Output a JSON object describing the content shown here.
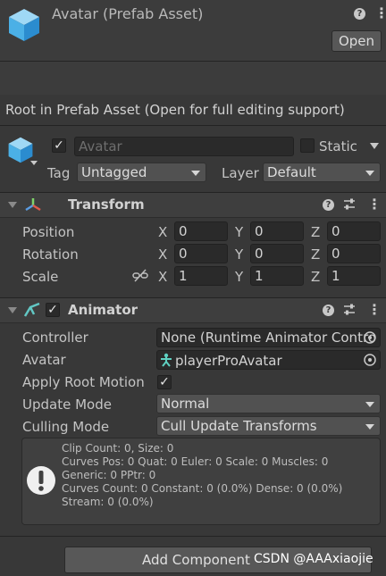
{
  "header": {
    "title": "Avatar (Prefab Asset)",
    "open_label": "Open"
  },
  "info_text": "Root in Prefab Asset (Open for full editing support)",
  "gameobject": {
    "name": "Avatar",
    "static_label": "Static",
    "tag_label": "Tag",
    "tag_value": "Untagged",
    "layer_label": "Layer",
    "layer_value": "Default"
  },
  "transform": {
    "title": "Transform",
    "rows": [
      {
        "label": "Position",
        "x": "0",
        "y": "0",
        "z": "0"
      },
      {
        "label": "Rotation",
        "x": "0",
        "y": "0",
        "z": "0"
      },
      {
        "label": "Scale",
        "x": "1",
        "y": "1",
        "z": "1"
      }
    ],
    "axis_x": "X",
    "axis_y": "Y",
    "axis_z": "Z"
  },
  "animator": {
    "title": "Animator",
    "controller_label": "Controller",
    "controller_value": "None (Runtime Animator Contro",
    "avatar_label": "Avatar",
    "avatar_value": "playerProAvatar",
    "apply_root_motion_label": "Apply Root Motion",
    "update_mode_label": "Update Mode",
    "update_mode_value": "Normal",
    "culling_mode_label": "Culling Mode",
    "culling_mode_value": "Cull Update Transforms",
    "info_lines": [
      "Clip Count: 0, Size: 0",
      "Curves Pos: 0 Quat: 0 Euler: 0 Scale: 0 Muscles: 0",
      "Generic: 0 PPtr: 0",
      "Curves Count: 0 Constant: 0 (0.0%) Dense: 0 (0.0%)",
      "Stream: 0 (0.0%)"
    ]
  },
  "add_component_label": "Add Component",
  "watermark": "CSDN @AAAxiaojie",
  "icons": [
    "cube-icon",
    "help-icon",
    "kebab-menu-icon",
    "transform-axes-icon",
    "preset-sliders-icon",
    "animator-icon",
    "link-scale-icon",
    "object-picker-icon",
    "humanoid-icon",
    "warning-icon"
  ]
}
